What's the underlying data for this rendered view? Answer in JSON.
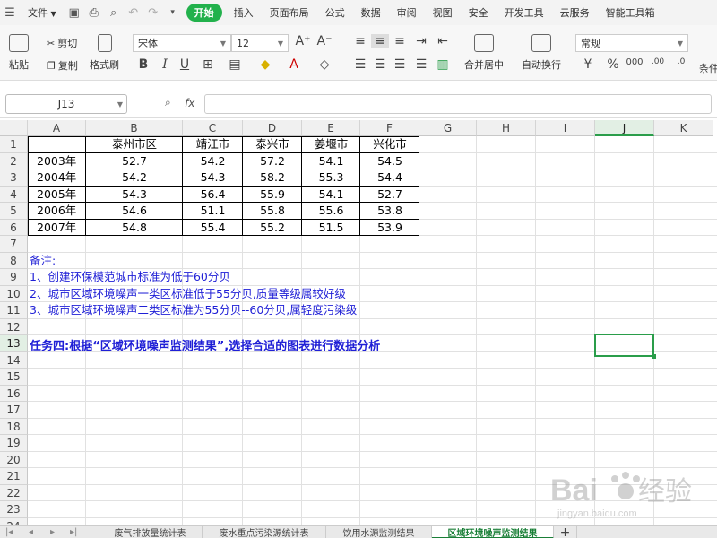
{
  "menu": {
    "file_label": "文件",
    "tabs": [
      "开始",
      "插入",
      "页面布局",
      "公式",
      "数据",
      "审阅",
      "视图",
      "安全",
      "开发工具",
      "云服务",
      "智能工具箱"
    ],
    "active_tab": "开始"
  },
  "ribbon": {
    "paste": "粘贴",
    "cut": "剪切",
    "copy": "复制",
    "format_painter": "格式刷",
    "font_name": "宋体",
    "font_size": "12",
    "merge_center": "合并居中",
    "wrap_text": "自动换行",
    "number_format": "常规",
    "conditional": "条件"
  },
  "formula_bar": {
    "name_box": "J13",
    "fx": "fx",
    "content": ""
  },
  "columns": [
    "A",
    "B",
    "C",
    "D",
    "E",
    "F",
    "G",
    "H",
    "I",
    "J",
    "K"
  ],
  "rows": [
    "1",
    "2",
    "3",
    "4",
    "5",
    "6",
    "7",
    "8",
    "9",
    "10",
    "11",
    "12",
    "13",
    "14",
    "15",
    "16",
    "17",
    "18",
    "19",
    "20",
    "21",
    "22",
    "23",
    "24"
  ],
  "table": {
    "header": [
      "",
      "泰州市区",
      "靖江市",
      "泰兴市",
      "姜堰市",
      "兴化市"
    ],
    "data": [
      [
        "2003年",
        "52.7",
        "54.2",
        "57.2",
        "54.1",
        "54.5"
      ],
      [
        "2004年",
        "54.2",
        "54.3",
        "58.2",
        "55.3",
        "54.4"
      ],
      [
        "2005年",
        "54.3",
        "56.4",
        "55.9",
        "54.1",
        "52.7"
      ],
      [
        "2006年",
        "54.6",
        "51.1",
        "55.8",
        "55.6",
        "53.8"
      ],
      [
        "2007年",
        "54.8",
        "55.4",
        "55.2",
        "51.5",
        "53.9"
      ]
    ]
  },
  "notes": {
    "title": "备注:",
    "line1": "1、创建环保模范城市标准为低于60分贝",
    "line2": "2、城市区域环境噪声一类区标准低于55分贝,质量等级属较好级",
    "line3": "3、城市区域环境噪声二类区标准为55分贝--60分贝,属轻度污染级"
  },
  "task": "任务四:根据“区域环境噪声监测结果”,选择合适的图表进行数据分析",
  "sheet_tabs": [
    "废气排放量统计表",
    "废水重点污染源统计表",
    "饮用水源监测结果",
    "区域环境噪声监测结果"
  ],
  "active_sheet": "区域环境噪声监测结果",
  "add_sheet": "+",
  "watermark": {
    "brand": "Baidu经验",
    "url": "jingyan.baidu.com"
  },
  "colors": {
    "accent": "#22b14c",
    "note_text": "#1f1fd6",
    "selection": "#2a9d4a"
  }
}
